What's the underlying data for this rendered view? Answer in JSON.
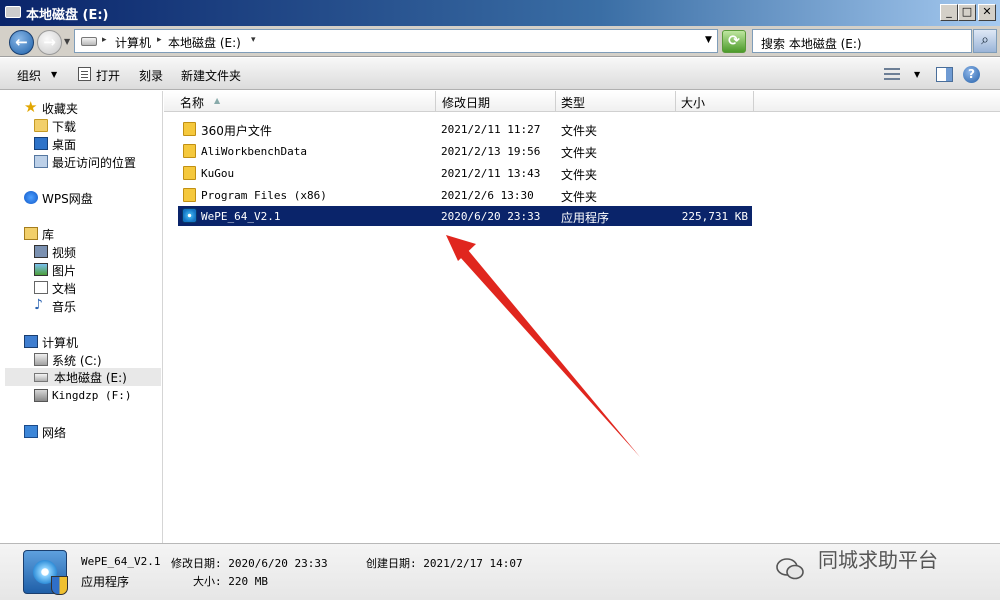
{
  "window": {
    "title": "本地磁盘 (E:)"
  },
  "titlebar_buttons": {
    "minimize": "_",
    "maximize": "□",
    "close": "✕"
  },
  "address": {
    "crumbs": [
      "计算机",
      "本地磁盘 (E:)"
    ],
    "search_placeholder": "搜索 本地磁盘 (E:)"
  },
  "toolbar": {
    "organize": "组织",
    "open": "打开",
    "burn": "刻录",
    "new_folder": "新建文件夹"
  },
  "sidebar": {
    "favorites": {
      "label": "收藏夹",
      "items": [
        "下载",
        "桌面",
        "最近访问的位置"
      ]
    },
    "wps": "WPS网盘",
    "library": {
      "label": "库",
      "items": [
        "视频",
        "图片",
        "文档",
        "音乐"
      ]
    },
    "computer": {
      "label": "计算机",
      "items": [
        "系统 (C:)",
        "本地磁盘 (E:)",
        "Kingdzp (F:)"
      ]
    },
    "network": "网络"
  },
  "columns": {
    "name": "名称",
    "date": "修改日期",
    "type": "类型",
    "size": "大小"
  },
  "files": [
    {
      "name": "360用户文件",
      "date": "2021/2/11 11:27",
      "type": "文件夹",
      "size": "",
      "icon": "folder-icon"
    },
    {
      "name": "AliWorkbenchData",
      "date": "2021/2/13 19:56",
      "type": "文件夹",
      "size": "",
      "icon": "folder-icon"
    },
    {
      "name": "KuGou",
      "date": "2021/2/11 13:43",
      "type": "文件夹",
      "size": "",
      "icon": "folder-icon"
    },
    {
      "name": "Program Files (x86)",
      "date": "2021/2/6 13:30",
      "type": "文件夹",
      "size": "",
      "icon": "folder-icon"
    },
    {
      "name": "WePE_64_V2.1",
      "date": "2020/6/20 23:33",
      "type": "应用程序",
      "size": "225,731 KB",
      "icon": "wepe-app-icon"
    }
  ],
  "details": {
    "name": "WePE_64_V2.1",
    "modified": "修改日期: 2020/6/20 23:33",
    "created": "创建日期: 2021/2/17 14:07",
    "type": "应用程序",
    "size": "大小: 220 MB"
  },
  "watermark": "同城求助平台",
  "colors": {
    "selection": "#0a246a",
    "arrow": "#e0261e"
  }
}
